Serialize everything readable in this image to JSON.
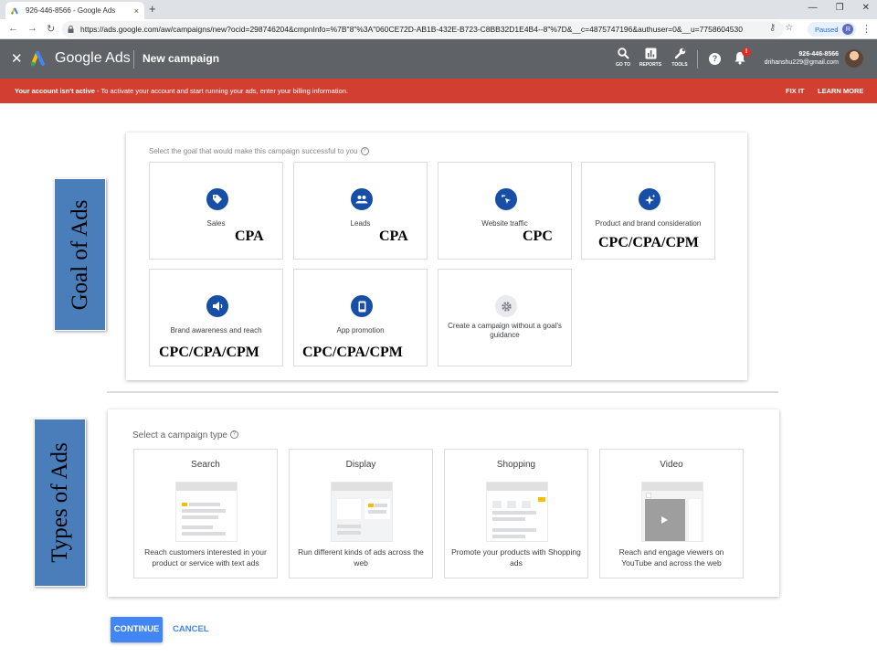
{
  "browser": {
    "tab_title": "926-446-8566 - Google Ads",
    "tab_close": "×",
    "new_tab": "+",
    "url": "https://ads.google.com/aw/campaigns/new?ocid=298746204&cmpnInfo=%7B\"8\"%3A\"060CE72D-AB1B-432E-B723-C8BB32D1E4B4--8\"%7D&__c=4875747196&authuser=0&__u=7758604530",
    "profile_status": "Paused",
    "profile_initial": "R",
    "icons": [
      "back-icon",
      "forward-icon",
      "reload-icon",
      "lock-icon",
      "key-icon",
      "star-icon",
      "menu-icon"
    ]
  },
  "header": {
    "brand": "Google Ads",
    "page_title": "New campaign",
    "tools": [
      {
        "label": "GO TO",
        "icon": "search-icon"
      },
      {
        "label": "REPORTS",
        "icon": "reports-icon"
      },
      {
        "label": "TOOLS",
        "icon": "wrench-icon"
      }
    ],
    "help": "?",
    "notification_badge": "!",
    "account_id": "926-446-8566",
    "account_email": "drihanshu229@gmail.com"
  },
  "alert": {
    "bold": "Your account isn't active",
    "text": " - To activate your account and start running your ads, enter your billing information.",
    "fix": "FIX IT",
    "learn": "LEARN MORE",
    "color": "#d23f31"
  },
  "goal": {
    "prompt": "Select the goal that would make this campaign successful to you",
    "help": "?",
    "items": [
      {
        "label": "Sales",
        "icon": "tag-icon"
      },
      {
        "label": "Leads",
        "icon": "people-icon"
      },
      {
        "label": "Website traffic",
        "icon": "cursor-click-icon"
      },
      {
        "label": "Product and brand consideration",
        "icon": "sparkle-icon"
      },
      {
        "label": "Brand awareness and reach",
        "icon": "speaker-icon"
      },
      {
        "label": "App promotion",
        "icon": "phone-icon"
      },
      {
        "label": "Create a campaign without a goal's guidance",
        "icon": "gear-icon"
      }
    ]
  },
  "bid_labels": [
    "CPA",
    "CPA",
    "CPC",
    "CPC/CPA/CPM",
    "CPC/CPA/CPM",
    "CPC/CPA/CPM"
  ],
  "side_labels": {
    "goal": "Goal of Ads",
    "types": "Types of Ads"
  },
  "campaign_type": {
    "prompt": "Select a campaign type",
    "help": "?",
    "items": [
      {
        "name": "Search",
        "desc": "Reach customers interested in your product or service with text ads"
      },
      {
        "name": "Display",
        "desc": "Run different kinds of ads across the web"
      },
      {
        "name": "Shopping",
        "desc": "Promote your products with Shopping ads"
      },
      {
        "name": "Video",
        "desc": "Reach and engage viewers on YouTube and across the web"
      }
    ]
  },
  "actions": {
    "continue": "CONTINUE",
    "cancel": "CANCEL"
  },
  "colors": {
    "header": "#5f6368",
    "primary": "#4285f4",
    "goal_icon": "#174ea6",
    "side_label": "#4a7ebb",
    "accent_yellow": "#fbbc04"
  }
}
